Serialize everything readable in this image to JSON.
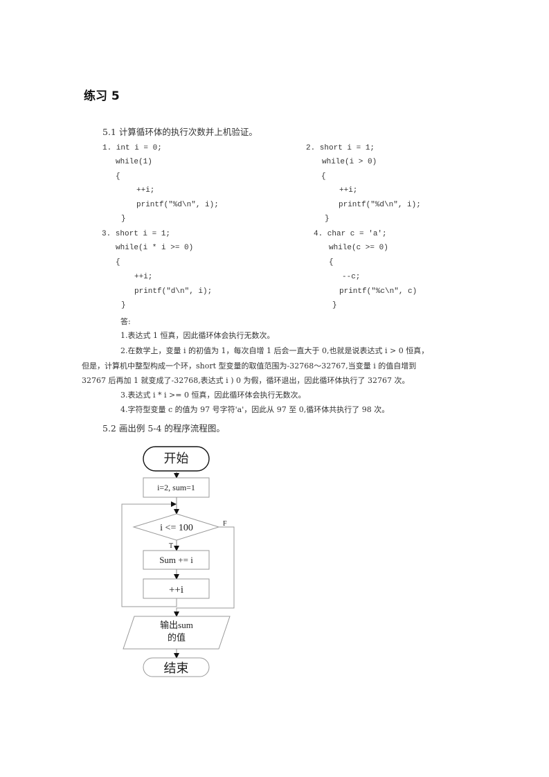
{
  "heading": "练习 5",
  "section1": {
    "title": "5.1 计算循环体的执行次数并上机验证。",
    "problems": [
      {
        "lines": [
          "1. int i = 0;",
          "while(1)",
          "{",
          "++i;",
          "printf(\"%d\\n\", i);",
          "}"
        ]
      },
      {
        "lines": [
          "2. short i = 1;",
          "while(i > 0)",
          "{",
          "++i;",
          "printf(\"%d\\n\", i);",
          "}"
        ]
      },
      {
        "lines": [
          "3. short i = 1;",
          "while(i * i >= 0)",
          "{",
          "++i;",
          "printf(\"d\\n\", i);",
          "}"
        ]
      },
      {
        "lines": [
          "4. char c = 'a';",
          "while(c >= 0)",
          "{",
          "--c;",
          "printf(\"%c\\n\", c)",
          "}"
        ]
      }
    ],
    "answer_label": "答:",
    "answers": [
      "1.表达式 1 恒真，因此循环体会执行无数次。",
      "2.在数学上，变量 i 的初值为 1，每次自增 1 后会一直大于 0,也就是说表达式 i > 0 恒真，",
      "但是，计算机中整型构成一个环，short 型变量的取值范围为-32768～32767,当变量 i 的值自增到",
      "32767 后再加 1 就变成了-32768,表达式 i ) 0 为假，循环退出，因此循环体执行了 32767 次。",
      "3.表达式 i * i >= 0 恒真，因此循环体会执行无数次。",
      "4.字符型变量 c 的值为 97 号字符'a'，因此从 97 至 0,循环体共执行了 98 次。"
    ]
  },
  "section2": {
    "title": "5.2 画出例 5-4 的程序流程图。"
  },
  "flowchart": {
    "start": "开始",
    "init": "i=2, sum=1",
    "condition": "i  <=  100",
    "true_label": "T",
    "false_label": "F",
    "body": "Sum  +=  i",
    "increment": "++i",
    "output_line1": "输出sum",
    "output_line2": "的值",
    "end": "结束"
  }
}
